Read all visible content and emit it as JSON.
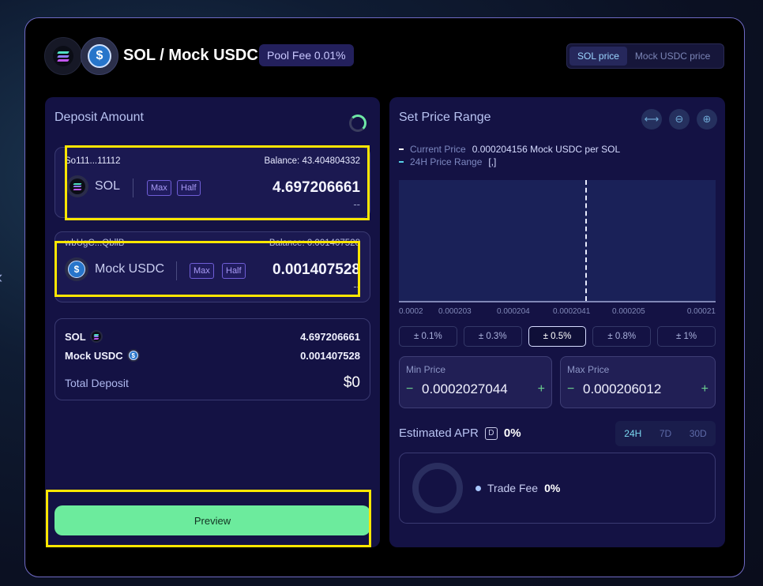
{
  "header": {
    "pair_title": "SOL / Mock USDC",
    "pool_fee": "Pool Fee 0.01%",
    "price_toggle": [
      {
        "label": "SOL price",
        "active": true
      },
      {
        "label": "Mock USDC price",
        "active": false
      }
    ]
  },
  "deposit": {
    "title": "Deposit Amount",
    "token_a": {
      "address": "So111...11112",
      "balance": "Balance: 43.404804332",
      "symbol": "SOL",
      "max_label": "Max",
      "half_label": "Half",
      "amount": "4.697206661",
      "usd": "--"
    },
    "token_b": {
      "address": "wbUgC...QbllB",
      "balance": "Balance: 0.001407528",
      "symbol": "Mock USDC",
      "max_label": "Max",
      "half_label": "Half",
      "amount": "0.001407528",
      "usd": "--"
    },
    "summary": {
      "row_a_label": "SOL",
      "row_a_value": "4.697206661",
      "row_b_label": "Mock USDC",
      "row_b_value": "0.001407528",
      "total_label": "Total Deposit",
      "total_value": "$0"
    },
    "preview_label": "Preview"
  },
  "range": {
    "title": "Set Price Range",
    "current_price_label": "Current Price",
    "current_price_value": "0.000204156 Mock USDC per SOL",
    "range_label": "24H Price Range",
    "range_value": "[,]",
    "axis": [
      "0.0002",
      "0.000203",
      "0.000204",
      "0.0002041",
      "0.000205",
      "0.00021"
    ],
    "pct_options": [
      {
        "label": "± 0.1%",
        "active": false
      },
      {
        "label": "± 0.3%",
        "active": false
      },
      {
        "label": "± 0.5%",
        "active": true
      },
      {
        "label": "± 0.8%",
        "active": false
      },
      {
        "label": "± 1%",
        "active": false
      }
    ],
    "min_price_label": "Min Price",
    "min_price_value": "0.0002027044",
    "max_price_label": "Max Price",
    "max_price_value": "0.000206012",
    "minus": "−",
    "plus": "+"
  },
  "apr": {
    "label": "Estimated APR",
    "badge": "D",
    "value": "0%",
    "periods": [
      {
        "label": "24H",
        "active": true
      },
      {
        "label": "7D",
        "active": false
      },
      {
        "label": "30D",
        "active": false
      }
    ],
    "trade_fee_label": "Trade Fee",
    "trade_fee_value": "0%"
  },
  "side_arrow": "‹",
  "colors": {
    "accent_green": "#6ceb9d",
    "panel": "#141244",
    "highlight": "#ffe600"
  }
}
